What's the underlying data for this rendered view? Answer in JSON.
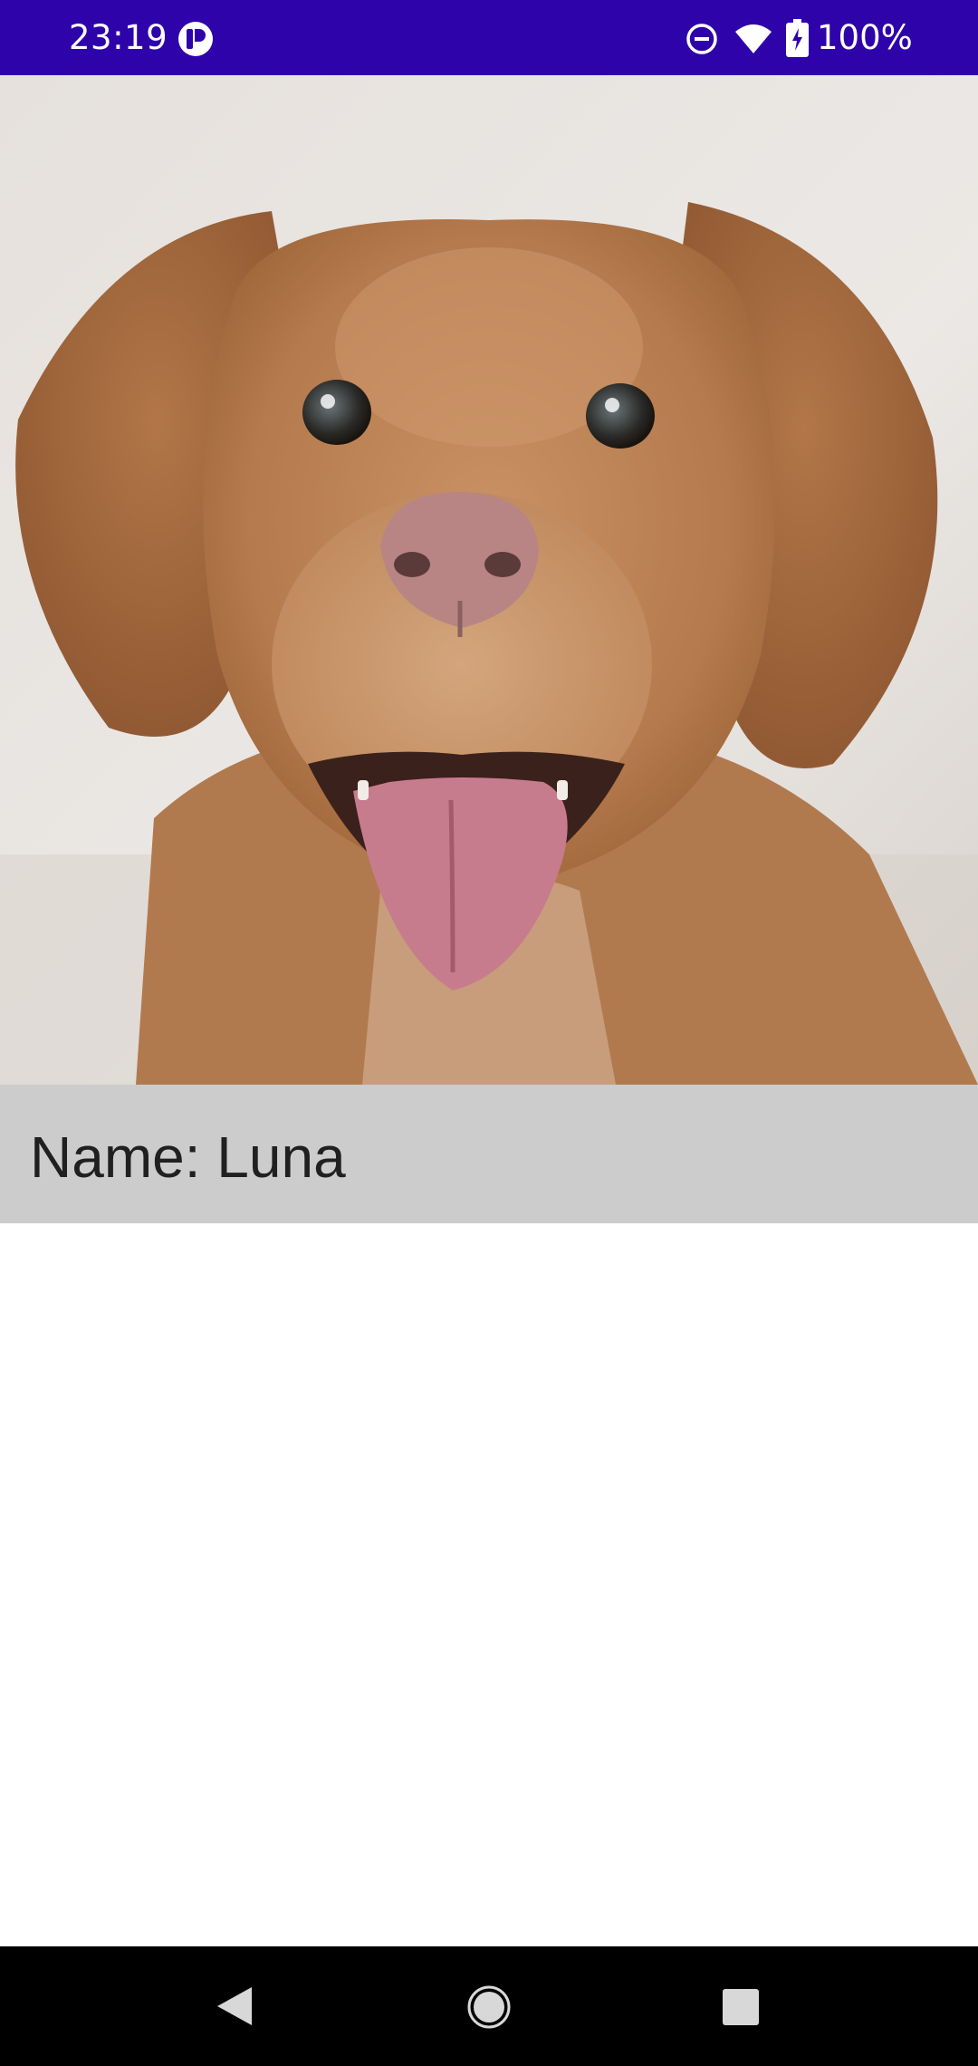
{
  "status_bar": {
    "time": "23:19",
    "battery_text": "100%",
    "background_color": "#2e04aa",
    "icons": [
      "app-notification-icon",
      "do-not-disturb-icon",
      "wifi-icon",
      "battery-charging-icon"
    ]
  },
  "photo": {
    "subject": "dog-photo"
  },
  "name_row": {
    "label": "Name: Luna",
    "background_color": "#cccccc"
  },
  "nav_bar": {
    "buttons": [
      "back",
      "home",
      "recents"
    ]
  }
}
